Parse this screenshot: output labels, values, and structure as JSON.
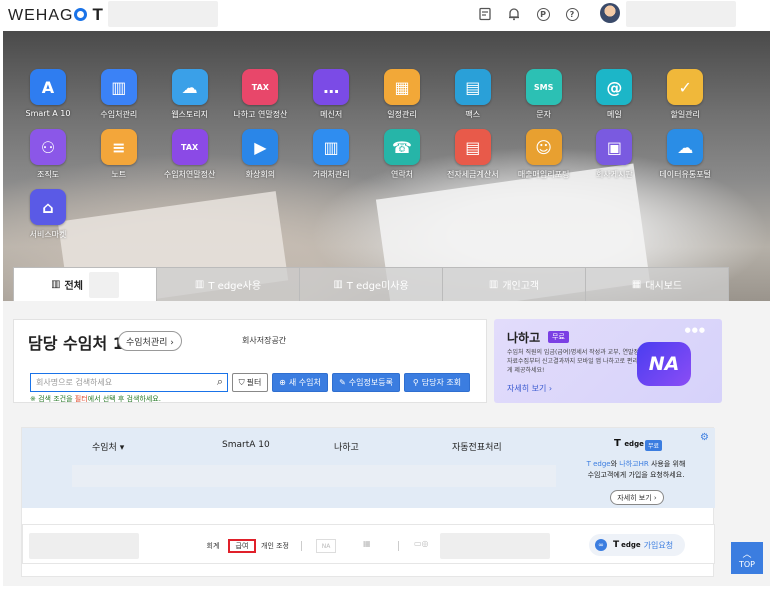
{
  "header": {
    "logo_text": "WEHAGO",
    "logo_t": "T",
    "icons": [
      "document-icon",
      "bell-icon",
      "points-icon",
      "help-icon"
    ]
  },
  "apps": [
    {
      "label": "Smart A 10",
      "icon": "smarta-icon",
      "color": "#2f7df0",
      "glyph": "A"
    },
    {
      "label": "수임처관리",
      "icon": "client-building-icon",
      "color": "#3b82f6",
      "glyph": "▥"
    },
    {
      "label": "웹스토리지",
      "icon": "cloud-storage-icon",
      "color": "#3aa0e8",
      "glyph": "☁"
    },
    {
      "label": "나하고 연말정산",
      "icon": "tax-settlement-icon",
      "color": "#e8476a",
      "glyph": "TAX"
    },
    {
      "label": "메신저",
      "icon": "messenger-icon",
      "color": "#7b4be6",
      "glyph": "…"
    },
    {
      "label": "일정관리",
      "icon": "calendar-icon",
      "color": "#f2a838",
      "glyph": "▦"
    },
    {
      "label": "팩스",
      "icon": "fax-icon",
      "color": "#2aa0d8",
      "glyph": "▤"
    },
    {
      "label": "문자",
      "icon": "sms-icon",
      "color": "#2cc0b4",
      "glyph": "SMS"
    },
    {
      "label": "메일",
      "icon": "mail-icon",
      "color": "#1cb6c8",
      "glyph": "@"
    },
    {
      "label": "할일관리",
      "icon": "todo-icon",
      "color": "#f0b83a",
      "glyph": "✓"
    },
    {
      "label": "조직도",
      "icon": "org-chart-icon",
      "color": "#8b57e8",
      "glyph": "⚇"
    },
    {
      "label": "노트",
      "icon": "note-icon",
      "color": "#f3a63a",
      "glyph": "≡"
    },
    {
      "label": "수임처연말정산",
      "icon": "client-tax-icon",
      "color": "#8b4ae6",
      "glyph": "TAX"
    },
    {
      "label": "화상회의",
      "icon": "video-meeting-icon",
      "color": "#2a86e8",
      "glyph": "▶"
    },
    {
      "label": "거래처관리",
      "icon": "partner-icon",
      "color": "#2f8df0",
      "glyph": "▥"
    },
    {
      "label": "연락처",
      "icon": "contacts-icon",
      "color": "#26b5a8",
      "glyph": "☎"
    },
    {
      "label": "전자세금계산서",
      "icon": "e-invoice-icon",
      "color": "#e85a4a",
      "glyph": "▤"
    },
    {
      "label": "매출매입리포팅",
      "icon": "sales-report-icon",
      "color": "#e8a030",
      "glyph": "☺"
    },
    {
      "label": "회사게시판",
      "icon": "board-icon",
      "color": "#7a5ae0",
      "glyph": "▣"
    },
    {
      "label": "데이터유통포털",
      "icon": "data-portal-icon",
      "color": "#2a8de6",
      "glyph": "☁"
    },
    {
      "label": "서비스마켓",
      "icon": "service-market-icon",
      "color": "#5a5ae6",
      "glyph": "⌂"
    }
  ],
  "tabs": [
    {
      "label": "전체",
      "active": true
    },
    {
      "label": "T edge사용",
      "active": false
    },
    {
      "label": "T edge미사용",
      "active": false
    },
    {
      "label": "개인고객",
      "active": false
    },
    {
      "label": "대시보드",
      "active": false
    }
  ],
  "client_card": {
    "title": "담당 수임처 1",
    "manage_pill": "수임처관리 ›",
    "subtitle": "회사저장공간",
    "search_placeholder": "회사명으로 검색하세요",
    "filter_btn": "필터",
    "new_btn": "새 수임처",
    "register_btn": "수임정보등록",
    "manager_btn": "담당자 조회",
    "note_prefix": "※ 검색 조건을 ",
    "note_highlight": "필터",
    "note_suffix": "에서 선택 후 검색하세요."
  },
  "banner": {
    "title": "나하고",
    "badge": "무료",
    "desc": "수임처 직원의 임금(급여)명세서 작성과 교부, 연말정산 자료수집부터 신고결과까지 모바일 앱 나하고로 편리하게 제공하세요!",
    "more": "자세히 보기 ›",
    "logo": "NA"
  },
  "table": {
    "headers": [
      "수임처 ▾",
      "SmartA 10",
      "나하고",
      "자동전표처리"
    ],
    "tedge_logo": "T",
    "tedge_text": "edge",
    "tedge_badge": "무료",
    "desc_line1_a": "T edge",
    "desc_line1_b": "와 ",
    "desc_line1_c": "나하고HR",
    "desc_line1_d": " 사용을 위해",
    "desc_line2": "수임고객에게 가입을 요청하세요.",
    "more_btn": "자세히 보기 ›"
  },
  "row": {
    "tag_accounting": "회계",
    "tag_payroll": "급여",
    "tag_personal": "개인 조정",
    "na_tag": "NA",
    "request_logo": "T",
    "request_edge": "edge",
    "request_text": "가입요청"
  },
  "top_button": "TOP"
}
